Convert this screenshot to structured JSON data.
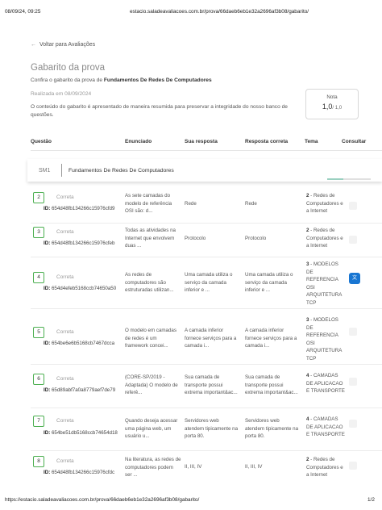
{
  "print": {
    "datetime": "08/09/24, 09:25",
    "url": "estacio.saladeavaliacoes.com.br/prova/66daeb6eb1e32a2696af3b08/gabarito/",
    "footer_url": "https://estacio.saladeavaliacoes.com.br/prova/66daeb6eb1e32a2696af3b08/gabarito/",
    "page": "1/2"
  },
  "nav": {
    "back_label": "Voltar para Avaliações",
    "back_icon": "arrow-left-icon"
  },
  "page": {
    "title": "Gabarito da prova",
    "subtitle_prefix": "Confira o gabarito da prova de ",
    "subtitle_course": "Fundamentos De Redes De Computadores",
    "realizada": "Realizada em 08/09/2024",
    "description": "O conteúdo do gabarito é apresentado de maneira resumida para preservar a integridade do nosso banco de questões."
  },
  "grade": {
    "label": "Nota",
    "value": "1,0",
    "of": "/ 1,0"
  },
  "table": {
    "headers": [
      "Questão",
      "Enunciado",
      "Sua resposta",
      "Resposta correta",
      "Tema",
      "Consultar"
    ]
  },
  "sticky": {
    "code": "SM1",
    "course": "Fundamentos De Redes De Computadores"
  },
  "rows": [
    {
      "num": "2",
      "status": "Correta",
      "id_label": "ID:",
      "id": "654d48fb134266c15976cfd9",
      "enunciado": "As sete camadas do modelo de referência OSI são: d...",
      "sua": "Rede",
      "correta": "Rede",
      "tema_num": "2",
      "tema": " - Redes de Computadores e a Internet"
    },
    {
      "num": "3",
      "status": "Correta",
      "id_label": "ID:",
      "id": "654d48fb134266c15976cfeb",
      "enunciado": "Todas as atividades na Internet que envolvem duas ...",
      "sua": "Protocolo",
      "correta": "Protocolo",
      "tema_num": "2",
      "tema": " - Redes de Computadores e a Internet"
    },
    {
      "num": "4",
      "status": "Correta",
      "id_label": "ID:",
      "id": "654d4efeb5168ccb74650a50",
      "enunciado": "As redes de computadores são estruturadas utilizan...",
      "sua": "Uma camada utiliza o serviço da camada inferior e ...",
      "correta": "Uma camada utiliza o serviço da camada inferior e ...",
      "tema_num": "3",
      "tema": " - MODELOS DE REFERENCIA OSI ARQUITETURA TCP"
    },
    {
      "num": "5",
      "status": "Correta",
      "id_label": "ID:",
      "id": "654be6e6b5168cb7467dcca",
      "enunciado": "O modelo em camadas de redes é um framework concei...",
      "sua": "A camada inferior fornece serviços para a camada i...",
      "correta": "A camada inferior fornece serviços para a camada i...",
      "tema_num": "3",
      "tema": " - MODELOS DE REFERENCIA OSI ARQUITETURA TCP"
    },
    {
      "num": "6",
      "status": "Correta",
      "id_label": "ID:",
      "id": "65d89abf7a0a8779aef7de79",
      "enunciado": "(CORE-SP/2019 - Adaptada) O modelo de referê...",
      "sua": "Sua camada de transporte possui extrema important&ac...",
      "correta": "Sua camada de transporte possui extrema important&ac...",
      "tema_num": "4",
      "tema": " - CAMADAS DE APLICACAO E TRANSPORTE"
    },
    {
      "num": "7",
      "status": "Correta",
      "id_label": "ID:",
      "id": "654be51db5168ccb74654d18",
      "enunciado": "Quando deseja acessar uma página web, um usuário u...",
      "sua": "Servidores web atendem tipicamente na porta 80.",
      "correta": "Servidores web atendem tipicamente na porta 80.",
      "tema_num": "4",
      "tema": " - CAMADAS DE APLICACAO E TRANSPORTE"
    },
    {
      "num": "8",
      "status": "Correta",
      "id_label": "ID:",
      "id": "654d48fb134266c15976cfdc",
      "enunciado": "Na literatura, as redes de computadores podem ser ...",
      "sua": "II, III, IV",
      "correta": "II, III, IV",
      "tema_num": "2",
      "tema": " - Redes de Computadores e a Internet"
    }
  ],
  "translate_icon": "translate-icon"
}
